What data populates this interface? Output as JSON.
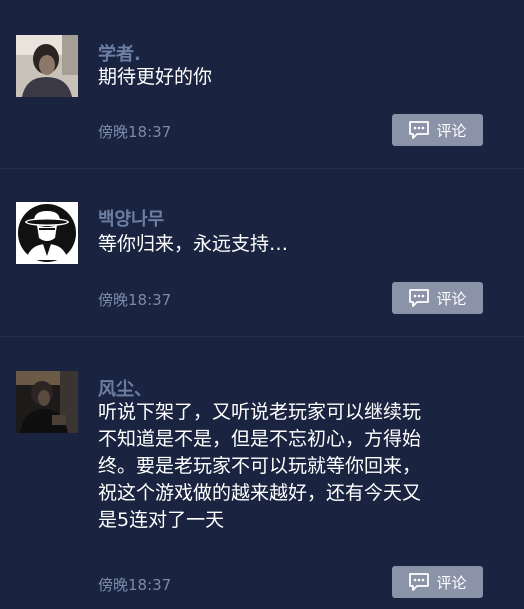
{
  "comments": [
    {
      "username": "学者.",
      "text": "期待更好的你",
      "time": "傍晚18:37",
      "reply_label": "评论",
      "avatar_icon": "portrait-photo-icon"
    },
    {
      "username": "백양나무",
      "text": "等你归来，永远支持…",
      "time": "傍晚18:37",
      "reply_label": "评论",
      "avatar_icon": "fedora-man-silhouette-icon"
    },
    {
      "username": "风尘、",
      "text_lines": [
        "听说下架了，又听说老玩家可以继续玩",
        "不知道是不是，但是不忘初心，方得始",
        "终。要是老玩家不可以玩就等你回来，",
        "祝这个游戏做的越来越好，还有今天又",
        "是5连对了一天"
      ],
      "time": "傍晚18:37",
      "reply_label": "评论",
      "avatar_icon": "dark-portrait-photo-icon"
    }
  ],
  "colors": {
    "background": "#1a2440",
    "username": "#6d7ea3",
    "time": "#7a8aa8",
    "button": "#8a93a8"
  }
}
